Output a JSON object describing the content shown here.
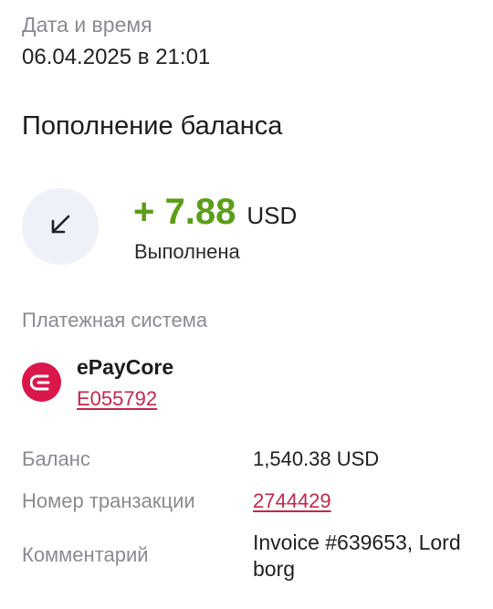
{
  "datetime": {
    "label": "Дата и время",
    "value": "06.04.2025 в 21:01"
  },
  "operation": {
    "title": "Пополнение баланса",
    "direction_icon": "arrow-down-left-icon",
    "amount": "+ 7.88",
    "currency": "USD",
    "status": "Выполнена",
    "amount_color": "#5a9e16"
  },
  "payment_system": {
    "label": "Платежная система",
    "logo_icon": "epaycore-logo-icon",
    "logo_color": "#d9174a",
    "name": "ePayCore",
    "account": "E055792"
  },
  "details": {
    "balance_label": "Баланс",
    "balance_value": "1,540.38 USD",
    "transaction_label": "Номер транзакции",
    "transaction_value": "2744429",
    "comment_label": "Комментарий",
    "comment_value": "Invoice #639653, Lord borg"
  }
}
